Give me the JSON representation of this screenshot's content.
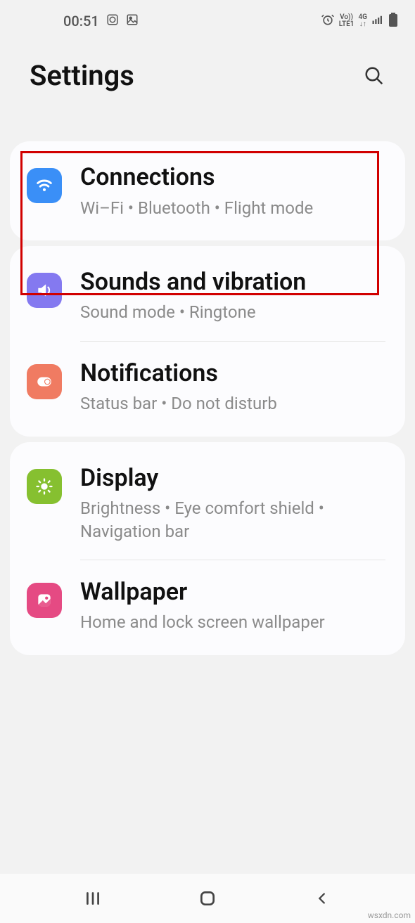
{
  "status": {
    "time": "00:51",
    "network_label1": "Vo))",
    "network_label2": "LTE1",
    "network_label3": "4G"
  },
  "header": {
    "title": "Settings"
  },
  "sections": {
    "connections": {
      "title": "Connections",
      "sub": "Wi–Fi  •  Bluetooth  •  Flight mode"
    },
    "sounds": {
      "title": "Sounds and vibration",
      "sub": "Sound mode  •  Ringtone"
    },
    "notifications": {
      "title": "Notifications",
      "sub": "Status bar  •  Do not disturb"
    },
    "display": {
      "title": "Display",
      "sub": "Brightness  •  Eye comfort shield  •  Navigation bar"
    },
    "wallpaper": {
      "title": "Wallpaper",
      "sub": "Home and lock screen wallpaper"
    }
  },
  "watermark": "wsxdn.com"
}
